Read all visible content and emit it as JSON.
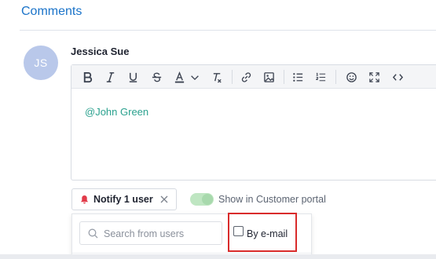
{
  "header": {
    "title": "Comments"
  },
  "comment": {
    "avatar_initials": "JS",
    "author": "Jessica Sue",
    "body_text": "@John Green"
  },
  "toolbar": {
    "buttons": [
      "bold-icon",
      "italic-icon",
      "underline-icon",
      "strikethrough-icon",
      "text-color-icon",
      "chevron-down-icon",
      "clear-format-icon",
      "link-icon",
      "image-icon",
      "bullet-list-icon",
      "numbered-list-icon",
      "emoji-icon",
      "fullscreen-icon",
      "code-icon"
    ]
  },
  "notify": {
    "label": "Notify 1 user"
  },
  "portal_toggle": {
    "label": "Show in Customer portal",
    "on": true
  },
  "user_search": {
    "placeholder": "Search from users",
    "value": ""
  },
  "email_option": {
    "label": "By e-mail",
    "checked": false
  },
  "colors": {
    "accent": "#1a73c9",
    "mention": "#2aa18e",
    "bell": "#e23b4a",
    "toggle": "#bfe6c2",
    "highlight_box": "#d92b2b"
  }
}
